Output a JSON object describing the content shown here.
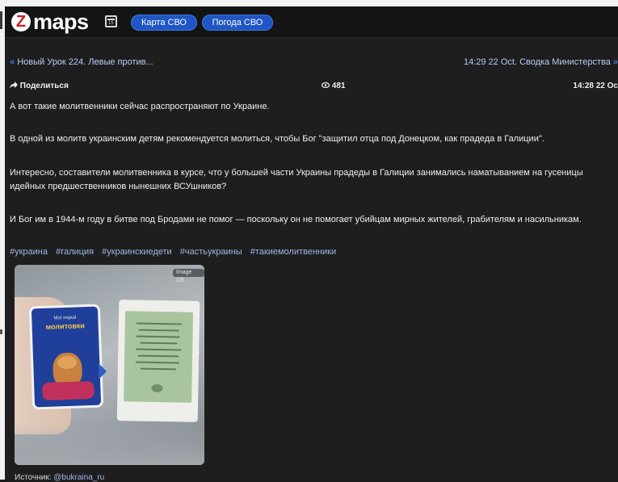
{
  "header": {
    "logo_letter": "Z",
    "logo_text": "maps",
    "calendar_icon": "calendar-icon",
    "calendar_icon_text": "15",
    "tabs": [
      {
        "label": "Карта СВО"
      },
      {
        "label": "Погода СВО"
      }
    ],
    "accent_color": "#1f56c4",
    "logo_color": "#d11f1f"
  },
  "navigation": {
    "prev_arrows": "«",
    "prev_label": "Новый Урок 224. Левые против...",
    "next_label": "14:29 22 Oct. Сводка Министерства",
    "next_arrows": "»"
  },
  "post": {
    "share_icon": "share-arrow-icon",
    "share_label": "Поделиться",
    "views_icon": "eye-icon",
    "views_count": "481",
    "timestamp": "14:28 22 Oc",
    "paragraphs": [
      "А вот такие молитвенники сейчас распространяют по Украине.",
      "В одной из молитв украинским детям рекомендуется молиться, чтобы Бог \"защитил отца под Донецком, как прадеда в Галиции\".",
      "Интересно, составители молитвенника в курсе, что у большей части Украины прадеды в Галиции занимались наматыванием на гусеницы идейных предшественников нынешних ВСУшников?",
      "И Бог им в 1944-м году в битве под Бродами не помог — поскольку он не помогает убийцам мирных жителей, грабителям и насильникам."
    ],
    "hashtags": [
      "#украина",
      "#галиция",
      "#украинскиедети",
      "#частьукраины",
      "#такиемолитвенники"
    ],
    "photo": {
      "badge": "Image 1/8",
      "card_title_small": "Мої перші",
      "card_title": "молитовки"
    },
    "source_label": "Источник:",
    "source_link": "@bukraina_ru"
  }
}
